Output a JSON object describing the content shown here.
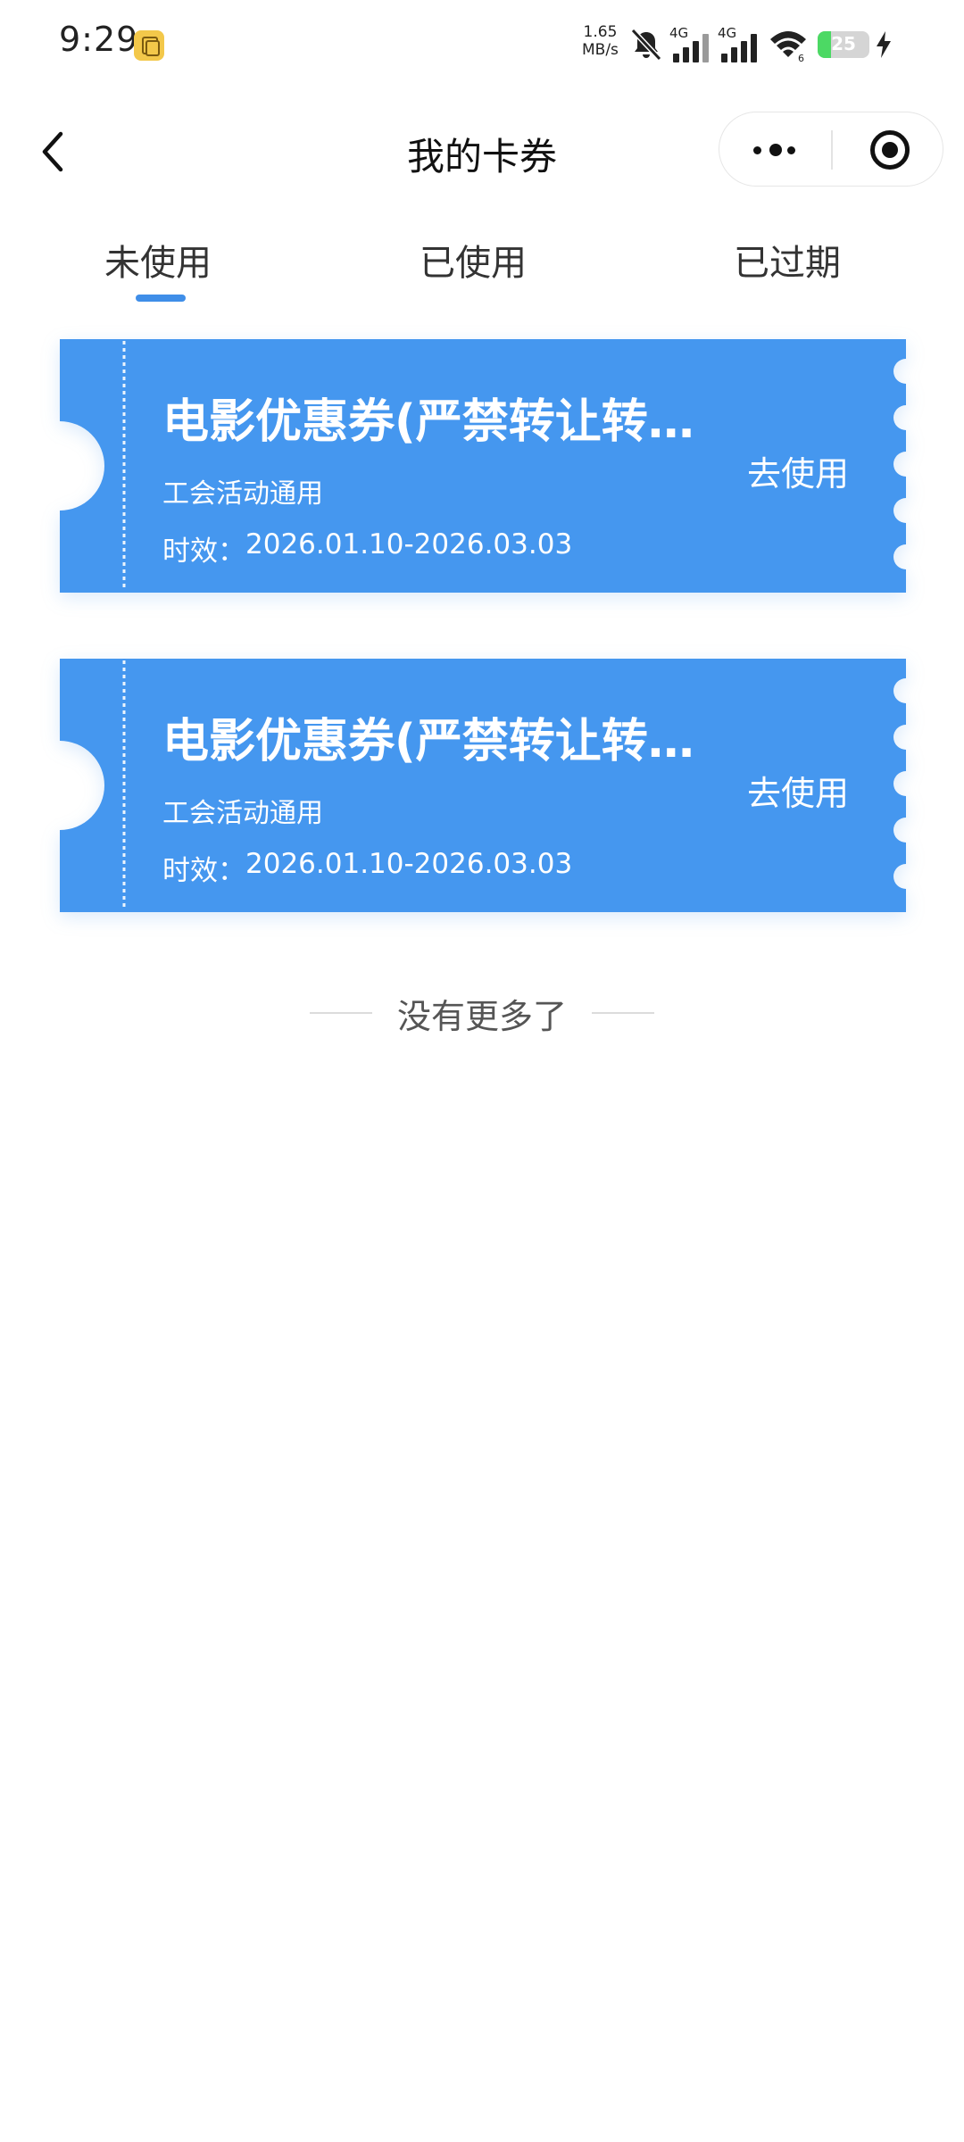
{
  "status_bar": {
    "time": "9:29",
    "net_speed_value": "1.65",
    "net_speed_unit": "MB/s",
    "signal1_label": "4G",
    "signal2_label": "4G",
    "wifi_label": "6",
    "battery_level": "25",
    "battery_fraction": 0.25,
    "battery_color": "#4cd964"
  },
  "nav": {
    "title": "我的卡券",
    "back_icon": "chevron-left-icon",
    "more_icon": "more-dots-icon",
    "close_icon": "target-icon"
  },
  "tabs": [
    {
      "label": "未使用",
      "active": true
    },
    {
      "label": "已使用",
      "active": false
    },
    {
      "label": "已过期",
      "active": false
    }
  ],
  "accent_color": "#3f8ee8",
  "coupon_color": "#4597ef",
  "coupons": [
    {
      "title": "电影优惠券(严禁转让转卖)",
      "scope": "工会活动通用",
      "validity_label": "时效：",
      "validity_range": "2026.01.10-2026.03.03",
      "action": "去使用"
    },
    {
      "title": "电影优惠券(严禁转让转卖)",
      "scope": "工会活动通用",
      "validity_label": "时效：",
      "validity_range": "2026.01.10-2026.03.03",
      "action": "去使用"
    }
  ],
  "footer": {
    "no_more": "没有更多了"
  }
}
